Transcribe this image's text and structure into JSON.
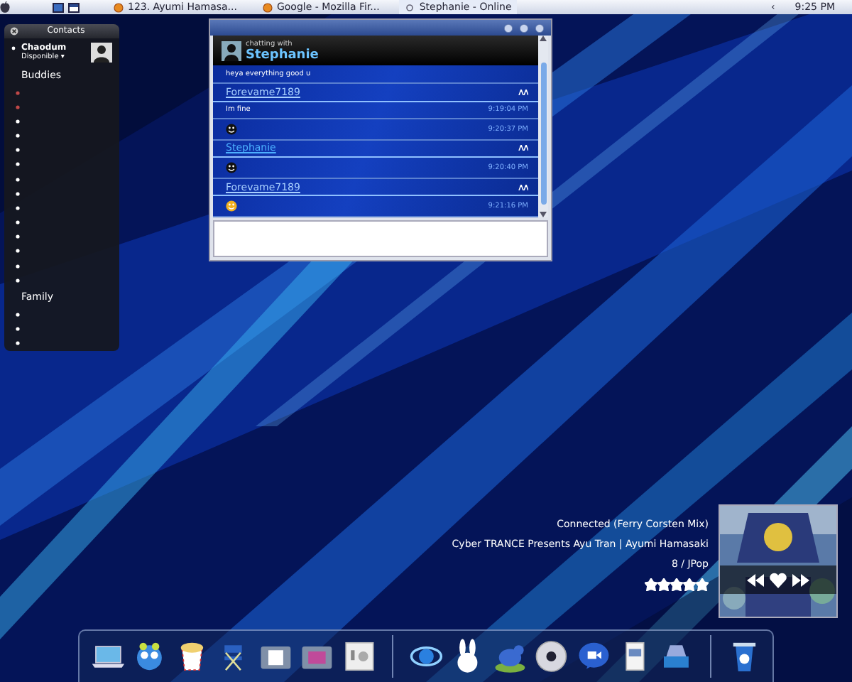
{
  "menubar": {
    "tasks": [
      {
        "label": "123. Ayumi Hamasa...",
        "selected": false
      },
      {
        "label": "Google - Mozilla Fir...",
        "selected": false
      },
      {
        "label": "Stephanie - Online",
        "selected": true
      }
    ],
    "tray_arrow": "‹",
    "clock": "9:25 PM"
  },
  "contacts": {
    "title": "Contacts",
    "user": {
      "name": "Chaodum",
      "status": "Disponible ▾"
    },
    "groups": [
      {
        "name": "Buddies",
        "members": [
          {
            "color": "#c04848"
          },
          {
            "color": "#c04848"
          },
          {
            "color": "#ffffff"
          },
          {
            "color": "#ffffff"
          },
          {
            "color": "#ffffff"
          },
          {
            "color": "#ffffff"
          },
          {
            "color": "#ffffff"
          },
          {
            "color": "#ffffff"
          },
          {
            "color": "#ffffff"
          },
          {
            "color": "#ffffff"
          },
          {
            "color": "#ffffff"
          },
          {
            "color": "#ffffff"
          },
          {
            "color": "#ffffff"
          },
          {
            "color": "#ffffff"
          }
        ]
      },
      {
        "name": "Family",
        "members": [
          {
            "color": "#ffffff"
          },
          {
            "color": "#ffffff"
          },
          {
            "color": "#ffffff"
          }
        ]
      }
    ]
  },
  "chat": {
    "header_caption": "chatting with",
    "contact": "Stephanie",
    "messages": [
      {
        "kind": "text",
        "text": "heya everything good u"
      },
      {
        "kind": "sender",
        "name": "Forevame7189",
        "self": true
      },
      {
        "kind": "text",
        "text": "Im fine",
        "time": "9:19:04 PM"
      },
      {
        "kind": "emoticon",
        "color": "#111111",
        "time": "9:20:37 PM"
      },
      {
        "kind": "sender",
        "name": "Stephanie",
        "self": false
      },
      {
        "kind": "emoticon",
        "color": "#111111",
        "time": "9:20:40 PM"
      },
      {
        "kind": "sender",
        "name": "Forevame7189",
        "self": true
      },
      {
        "kind": "emoticon",
        "color": "#f0b020",
        "time": "9:21:16 PM"
      }
    ]
  },
  "music": {
    "track": "Connected (Ferry Corsten Mix)",
    "album_artist": "Cyber TRANCE Presents Ayu Tran | Ayumi Hamasaki",
    "number_genre": "8 / JPop",
    "stars": 5
  }
}
